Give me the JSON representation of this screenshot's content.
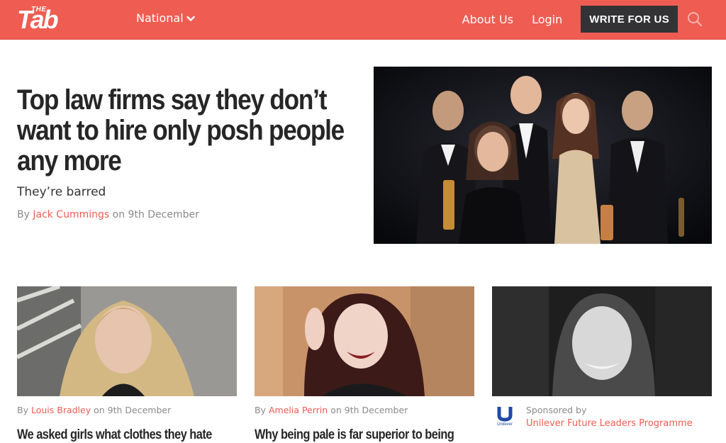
{
  "header": {
    "logo_small": "THE",
    "logo_big": "Tab",
    "region_label": "National",
    "about_label": "About Us",
    "login_label": "Login",
    "write_label": "WRITE FOR US",
    "icons": {
      "search": "search-icon",
      "chevron": "chevron-down-icon"
    }
  },
  "hero": {
    "title": "Top law firms say they don’t want to hire only posh people any more",
    "subtitle": "They’re barred",
    "by": "By",
    "author": "Jack Cummings",
    "on": "on",
    "date": "9th December"
  },
  "cards": [
    {
      "by": "By",
      "author": "Louis Bradley",
      "on": "on",
      "date": "9th December",
      "title": "We asked girls what clothes they hate"
    },
    {
      "by": "By",
      "author": "Amelia Perrin",
      "on": "on",
      "date": "9th December",
      "title": "Why being pale is far superior to being"
    },
    {
      "sponsored_label": "Sponsored by",
      "sponsor": "Unilever Future Leaders Programme",
      "logo_text": "Unilever"
    }
  ],
  "colors": {
    "brand": "#ef5c52",
    "dark_button": "#333336",
    "text": "#262626",
    "muted": "#8a8a8a"
  }
}
